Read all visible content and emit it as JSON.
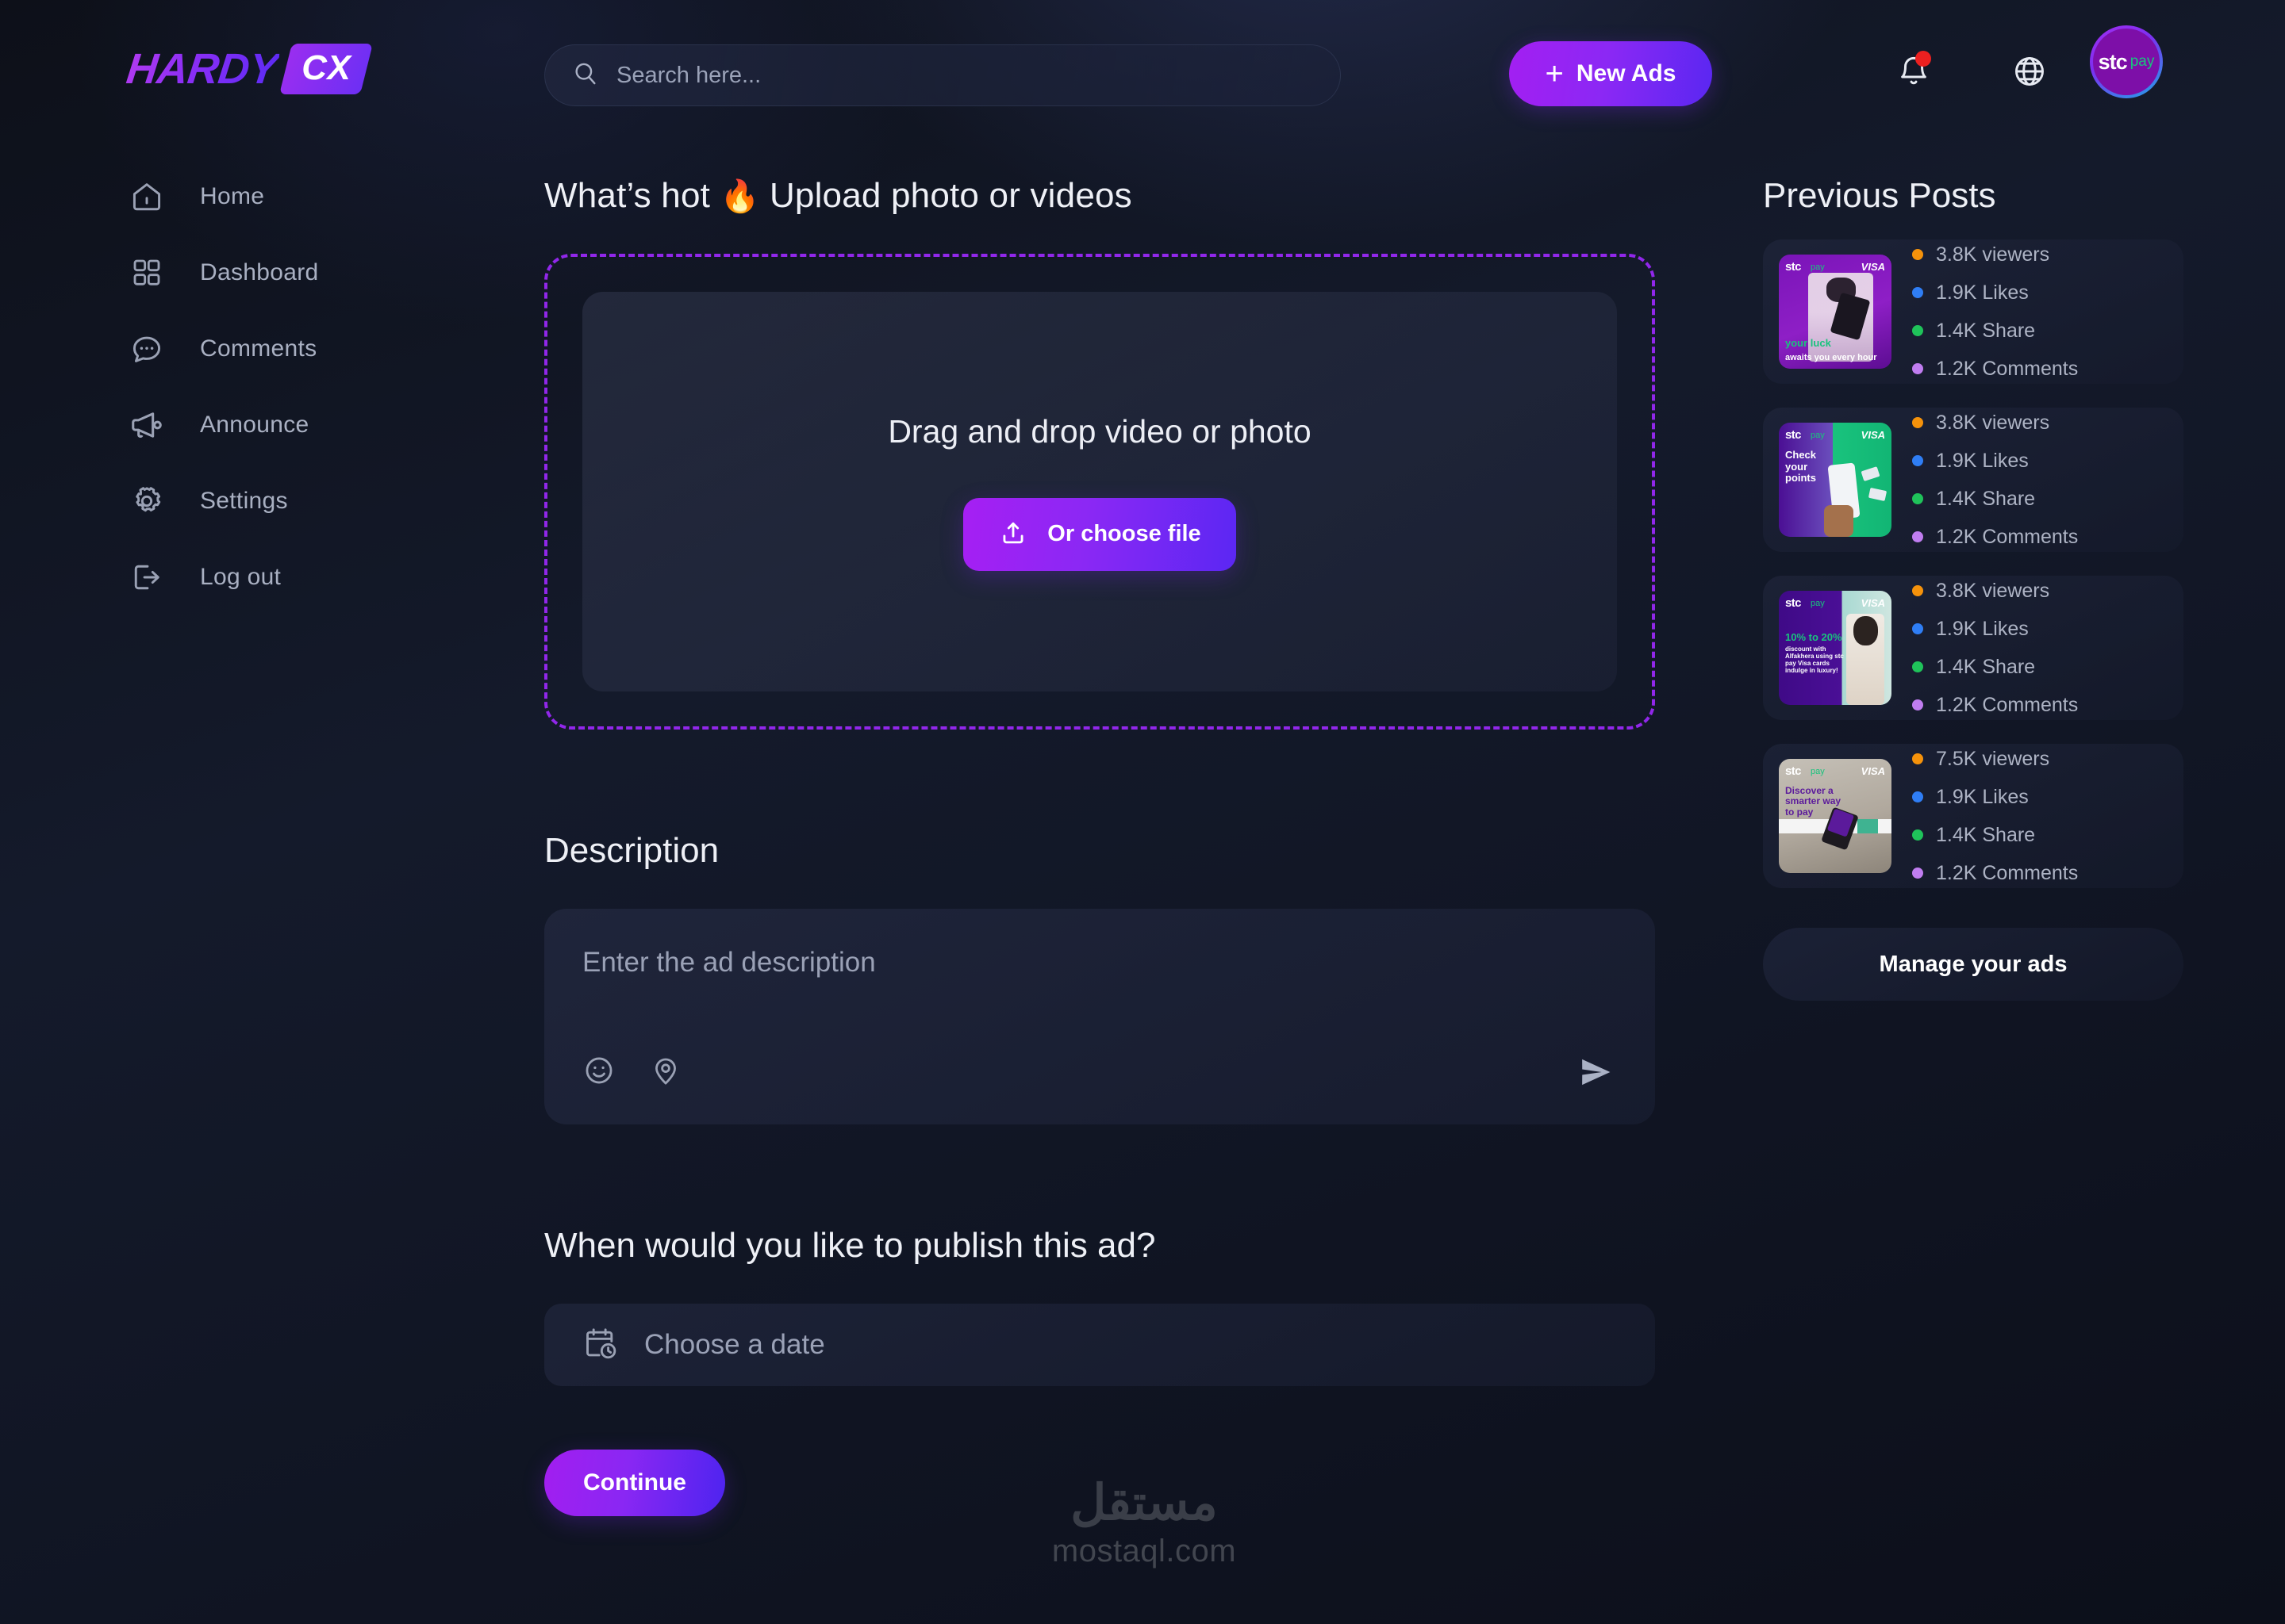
{
  "brand": {
    "name": "HARDY",
    "badge": "CX"
  },
  "header": {
    "search": {
      "placeholder": "Search here...",
      "icon": "search-icon"
    },
    "new_ads_label": "New Ads",
    "plus": "+",
    "bell_icon": "bell-icon",
    "globe_icon": "globe-icon",
    "avatar": {
      "stc": "stc",
      "pay": "pay"
    }
  },
  "sidebar": {
    "items": [
      {
        "label": "Home",
        "icon": "home-icon"
      },
      {
        "label": "Dashboard",
        "icon": "grid-icon"
      },
      {
        "label": "Comments",
        "icon": "chat-bubble-icon"
      },
      {
        "label": "Announce",
        "icon": "megaphone-icon"
      },
      {
        "label": "Settings",
        "icon": "gear-icon"
      },
      {
        "label": "Log out",
        "icon": "logout-icon"
      }
    ]
  },
  "main": {
    "upload_title_pre": "What’s hot ",
    "upload_title_emoji": "🔥",
    "upload_title_post": " Upload photo or videos",
    "dropzone_text": "Drag and drop video or photo",
    "choose_file_label": "Or choose file",
    "description_label": "Description",
    "description_placeholder": "Enter the ad description",
    "emoji_icon": "emoji-smile-icon",
    "location_icon": "location-pin-icon",
    "send_icon": "send-icon",
    "publish_label": "When would you like to publish this ad?",
    "date_placeholder": "Choose a date",
    "calendar_icon": "calendar-clock-icon",
    "continue_label": "Continue"
  },
  "right_panel": {
    "title": "Previous Posts",
    "manage_label": "Manage your ads",
    "posts": [
      {
        "thumb": {
          "brand": "stc",
          "pay": "pay",
          "visa": "VISA",
          "caption_green": "your luck",
          "caption_white": "awaits you every hour",
          "bg": "#6b10a8",
          "bg2": "#9726c9"
        },
        "stats": [
          {
            "value": "3.8K viewers",
            "color": "#f5920b"
          },
          {
            "value": "1.9K Likes",
            "color": "#2f7ef5"
          },
          {
            "value": "1.4K Share",
            "color": "#1fc35a"
          },
          {
            "value": "1.2K Comments",
            "color": "#c07df0"
          }
        ]
      },
      {
        "thumb": {
          "brand": "stc",
          "pay": "pay",
          "visa": "VISA",
          "caption_green": "",
          "caption_white": "Check your points",
          "bg": "#4b0f94",
          "bg2": "#19c37d"
        },
        "stats": [
          {
            "value": "3.8K viewers",
            "color": "#f5920b"
          },
          {
            "value": "1.9K Likes",
            "color": "#2f7ef5"
          },
          {
            "value": "1.4K Share",
            "color": "#1fc35a"
          },
          {
            "value": "1.2K Comments",
            "color": "#c07df0"
          }
        ]
      },
      {
        "thumb": {
          "brand": "stc",
          "pay": "pay",
          "visa": "VISA",
          "caption_green": "10% to 20%",
          "caption_white": "discount with Alfakhera using stc pay Visa cards indulge in luxury!",
          "bg": "#3f0a87",
          "bg2": "#a8d9d2"
        },
        "stats": [
          {
            "value": "3.8K viewers",
            "color": "#f5920b"
          },
          {
            "value": "1.9K Likes",
            "color": "#2f7ef5"
          },
          {
            "value": "1.4K Share",
            "color": "#1fc35a"
          },
          {
            "value": "1.2K Comments",
            "color": "#c07df0"
          }
        ]
      },
      {
        "thumb": {
          "brand": "stc",
          "pay": "pay",
          "visa": "VISA",
          "caption_green": "",
          "caption_white": "Discover a smarter way to pay",
          "bg": "#b4afa8",
          "bg2": "#c8c3ba"
        },
        "stats": [
          {
            "value": "7.5K viewers",
            "color": "#f5920b"
          },
          {
            "value": "1.9K Likes",
            "color": "#2f7ef5"
          },
          {
            "value": "1.4K Share",
            "color": "#1fc35a"
          },
          {
            "value": "1.2K Comments",
            "color": "#c07df0"
          }
        ]
      }
    ]
  },
  "watermark": {
    "arabic": "مستقل",
    "latin": "mostaql.com"
  }
}
